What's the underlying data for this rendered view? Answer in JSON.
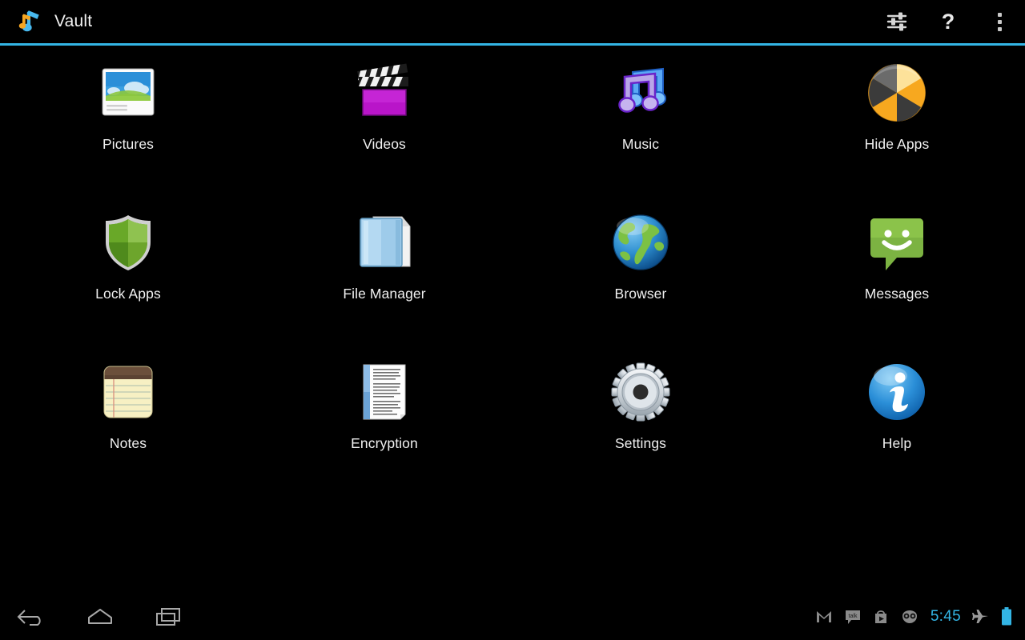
{
  "app": {
    "title": "Vault",
    "logo_icon": "music-note-logo-icon",
    "accent_color": "#33b5e5",
    "background_color": "#000000"
  },
  "action_bar": {
    "buttons": [
      {
        "name": "sliders-settings-icon",
        "label": "Settings sliders"
      },
      {
        "name": "help-question-icon",
        "label": "?"
      },
      {
        "name": "overflow-menu-icon",
        "label": "More options"
      }
    ],
    "help_glyph": "?"
  },
  "grid": {
    "items": [
      {
        "label": "Pictures",
        "icon": "pictures-icon"
      },
      {
        "label": "Videos",
        "icon": "videos-clapperboard-icon"
      },
      {
        "label": "Music",
        "icon": "music-notes-icon"
      },
      {
        "label": "Hide Apps",
        "icon": "hide-apps-burn-icon"
      },
      {
        "label": "Lock Apps",
        "icon": "lock-apps-shield-icon"
      },
      {
        "label": "File Manager",
        "icon": "file-manager-folder-icon"
      },
      {
        "label": "Browser",
        "icon": "browser-globe-icon"
      },
      {
        "label": "Messages",
        "icon": "messages-bubble-icon"
      },
      {
        "label": "Notes",
        "icon": "notes-pad-icon"
      },
      {
        "label": "Encryption",
        "icon": "encryption-document-icon"
      },
      {
        "label": "Settings",
        "icon": "settings-gear-icon"
      },
      {
        "label": "Help",
        "icon": "help-info-icon"
      }
    ]
  },
  "nav_bar": {
    "buttons": [
      {
        "name": "back-button",
        "label": "Back"
      },
      {
        "name": "home-button",
        "label": "Home"
      },
      {
        "name": "recent-apps-button",
        "label": "Recent apps"
      }
    ],
    "status_tray": {
      "icons": [
        {
          "name": "gmail-icon",
          "label": "Gmail"
        },
        {
          "name": "talk-icon",
          "label": "talk"
        },
        {
          "name": "play-store-icon",
          "label": "Play Store"
        },
        {
          "name": "cyanogenmod-icon",
          "label": "CyanogenMod"
        }
      ],
      "clock": "5:45",
      "airplane_icon": "airplane-mode-icon",
      "battery_icon": "battery-icon",
      "clock_color": "#33b5e5",
      "battery_color": "#33b5e5"
    }
  }
}
